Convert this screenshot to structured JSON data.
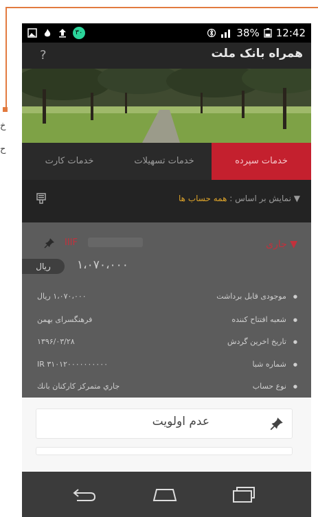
{
  "side_text": [
    "خ",
    "ح"
  ],
  "status_bar": {
    "badge": "۳۰",
    "battery": "38%",
    "time": "12:42"
  },
  "header": {
    "title": "همراه بانک ملت",
    "help": "?"
  },
  "tabs": [
    {
      "label": "خدمات سپرده",
      "active": true
    },
    {
      "label": "خدمات تسهیلات",
      "active": false
    },
    {
      "label": "خدمات کارت",
      "active": false
    }
  ],
  "filter": {
    "label": "نمایش بر اساس :",
    "value": "همه حساب ها"
  },
  "account": {
    "type": "جاری",
    "number": "IIIF",
    "currency": "ریال",
    "balance": "۱،۰۷۰،۰۰۰",
    "rows": [
      {
        "label": "موجودی قابل برداشت",
        "value": "۱،۰۷۰،۰۰۰ ریال"
      },
      {
        "label": "شعبه افتتاح کننده",
        "value": "فرهنگسرای بهمن"
      },
      {
        "label": "تاریخ اخرین گردش",
        "value": "۱۳۹۶/۰۳/۲۸"
      },
      {
        "label": "شماره شبا",
        "value": "IR ۳۱۰۱۲۰۰۰۰۰۰۰۰۰۰"
      },
      {
        "label": "نوع حساب",
        "value": "جاري متمركز كاركنان بانك"
      }
    ]
  },
  "sheet": {
    "option_label": "عدم اولویت"
  },
  "colors": {
    "accent_red": "#c4202e",
    "filter_value": "#d9a12a",
    "annotation": "#e27a3f"
  }
}
